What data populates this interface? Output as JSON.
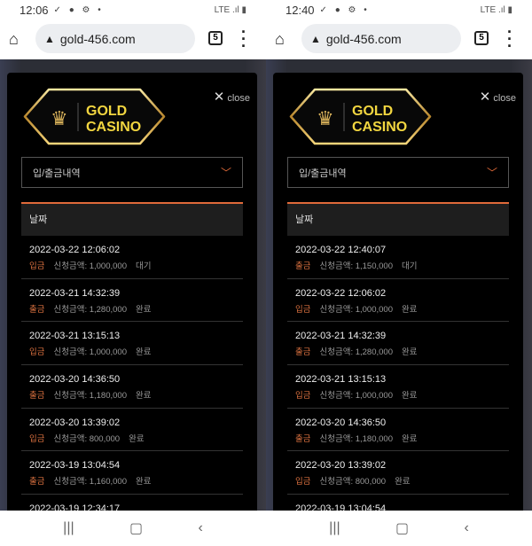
{
  "screens": [
    {
      "time": "12:06",
      "url": "gold-456.com",
      "tab_count": "5",
      "close_label": "close",
      "logo": {
        "line1": "GOLD",
        "line2": "CASINO"
      },
      "select_value": "입/출금내역",
      "column_header": "날짜",
      "rows": [
        {
          "date": "2022-03-22 12:06:02",
          "type": "입금",
          "amount": "신청금액: 1,000,000",
          "status": "대기"
        },
        {
          "date": "2022-03-21 14:32:39",
          "type": "출금",
          "amount": "신청금액: 1,280,000",
          "status": "완료"
        },
        {
          "date": "2022-03-21 13:15:13",
          "type": "입금",
          "amount": "신청금액: 1,000,000",
          "status": "완료"
        },
        {
          "date": "2022-03-20 14:36:50",
          "type": "출금",
          "amount": "신청금액: 1,180,000",
          "status": "완료"
        },
        {
          "date": "2022-03-20 13:39:02",
          "type": "입금",
          "amount": "신청금액: 800,000",
          "status": "완료"
        },
        {
          "date": "2022-03-19 13:04:54",
          "type": "출금",
          "amount": "신청금액: 1,160,000",
          "status": "완료"
        },
        {
          "date": "2022-03-19 12:34:17",
          "type": "",
          "amount": "",
          "status": ""
        }
      ]
    },
    {
      "time": "12:40",
      "url": "gold-456.com",
      "tab_count": "5",
      "close_label": "close",
      "logo": {
        "line1": "GOLD",
        "line2": "CASINO"
      },
      "select_value": "입/출금내역",
      "column_header": "날짜",
      "rows": [
        {
          "date": "2022-03-22 12:40:07",
          "type": "출금",
          "amount": "신청금액: 1,150,000",
          "status": "대기"
        },
        {
          "date": "2022-03-22 12:06:02",
          "type": "입금",
          "amount": "신청금액: 1,000,000",
          "status": "완료"
        },
        {
          "date": "2022-03-21 14:32:39",
          "type": "출금",
          "amount": "신청금액: 1,280,000",
          "status": "완료"
        },
        {
          "date": "2022-03-21 13:15:13",
          "type": "입금",
          "amount": "신청금액: 1,000,000",
          "status": "완료"
        },
        {
          "date": "2022-03-20 14:36:50",
          "type": "출금",
          "amount": "신청금액: 1,180,000",
          "status": "완료"
        },
        {
          "date": "2022-03-20 13:39:02",
          "type": "입금",
          "amount": "신청금액: 800,000",
          "status": "완료"
        },
        {
          "date": "2022-03-19 13:04:54",
          "type": "",
          "amount": "",
          "status": ""
        }
      ]
    }
  ],
  "colors": {
    "accent": "#e06a3a",
    "gold": "#f2d640"
  }
}
